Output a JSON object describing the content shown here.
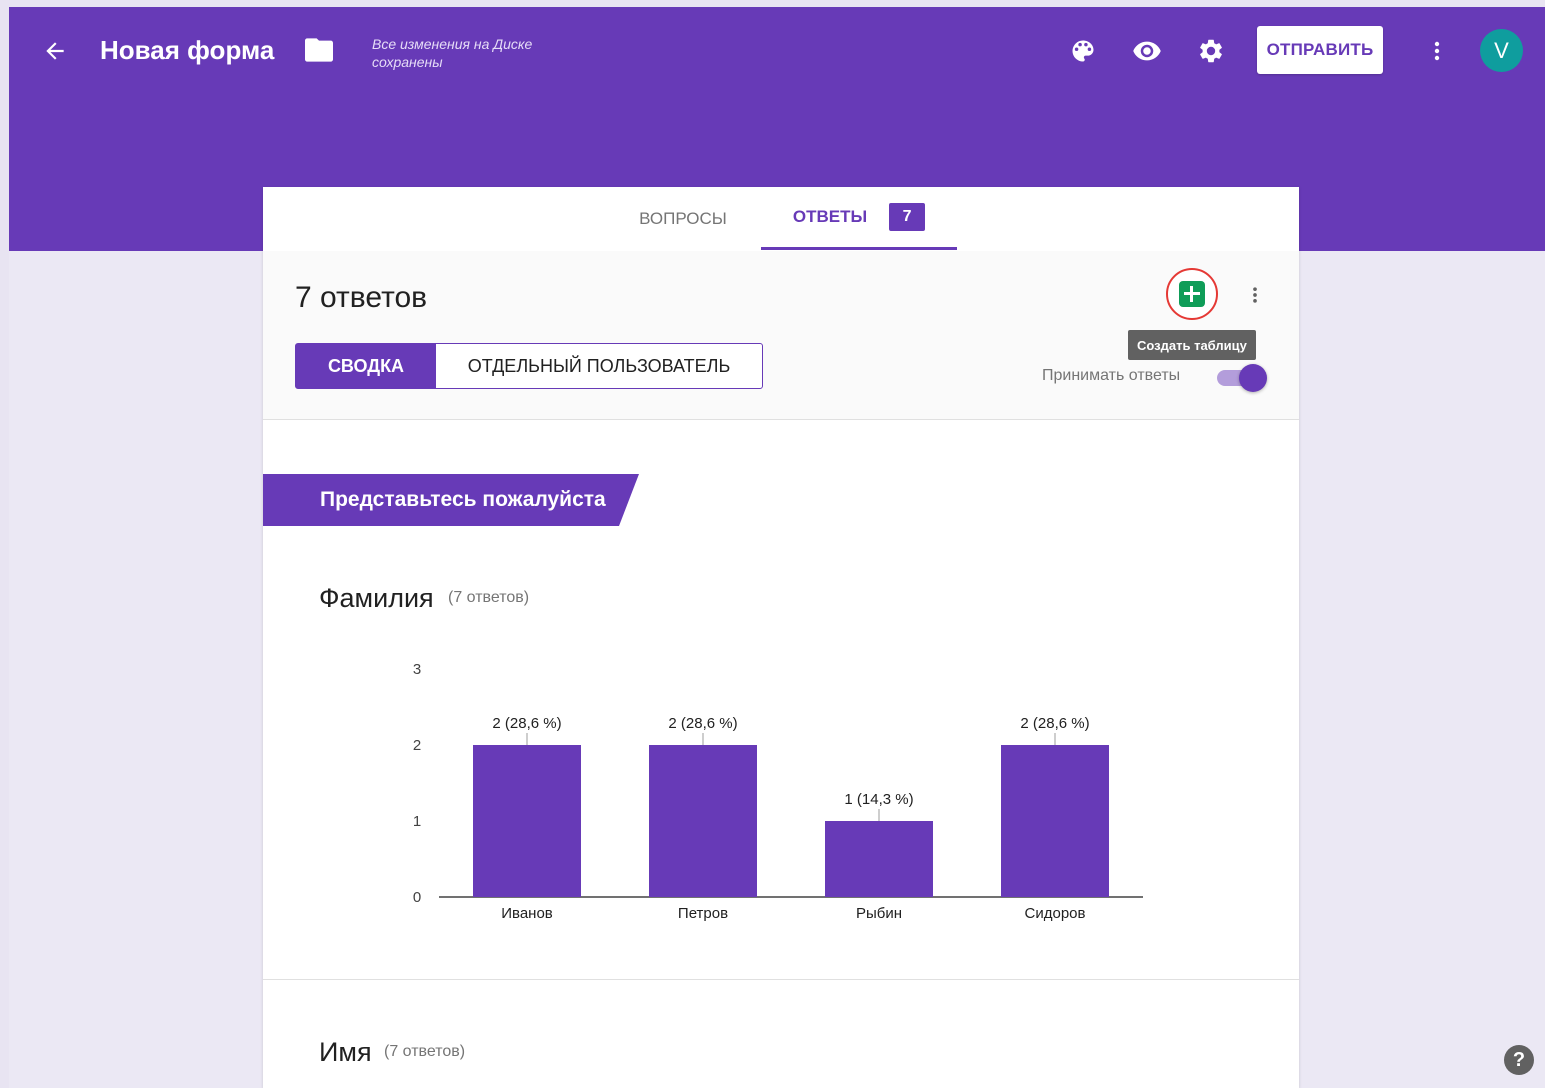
{
  "header": {
    "title": "Новая форма",
    "save_status": "Все изменения на Диске сохранены",
    "send_label": "ОТПРАВИТЬ",
    "avatar_letter": "V"
  },
  "tabs": {
    "questions": "ВОПРОСЫ",
    "responses": "ОТВЕТЫ",
    "responses_count": "7"
  },
  "summary": {
    "title": "7 ответов",
    "view_summary": "СВОДКА",
    "view_individual": "ОТДЕЛЬНЫЙ ПОЛЬЗОВАТЕЛЬ",
    "tooltip": "Создать таблицу",
    "accept_label": "Принимать ответы",
    "accepting": true
  },
  "section": {
    "title": "Представьтесь пожалуйста"
  },
  "questions": [
    {
      "title": "Фамилия",
      "count": "(7 ответов)"
    },
    {
      "title": "Имя",
      "count": "(7 ответов)"
    }
  ],
  "colors": {
    "accent": "#673ab7",
    "avatar": "#0f9d9e",
    "sheets": "#0f9d58",
    "highlight_circle": "#e53935"
  },
  "chart_data": {
    "type": "bar",
    "categories": [
      "Иванов",
      "Петров",
      "Рыбин",
      "Сидоров"
    ],
    "values": [
      2,
      2,
      1,
      2
    ],
    "data_labels": [
      "2 (28,6 %)",
      "2 (28,6 %)",
      "1 (14,3 %)",
      "2 (28,6 %)"
    ],
    "yticks": [
      "0",
      "1",
      "2",
      "3"
    ],
    "ylim": [
      0,
      3
    ],
    "grid": false
  }
}
